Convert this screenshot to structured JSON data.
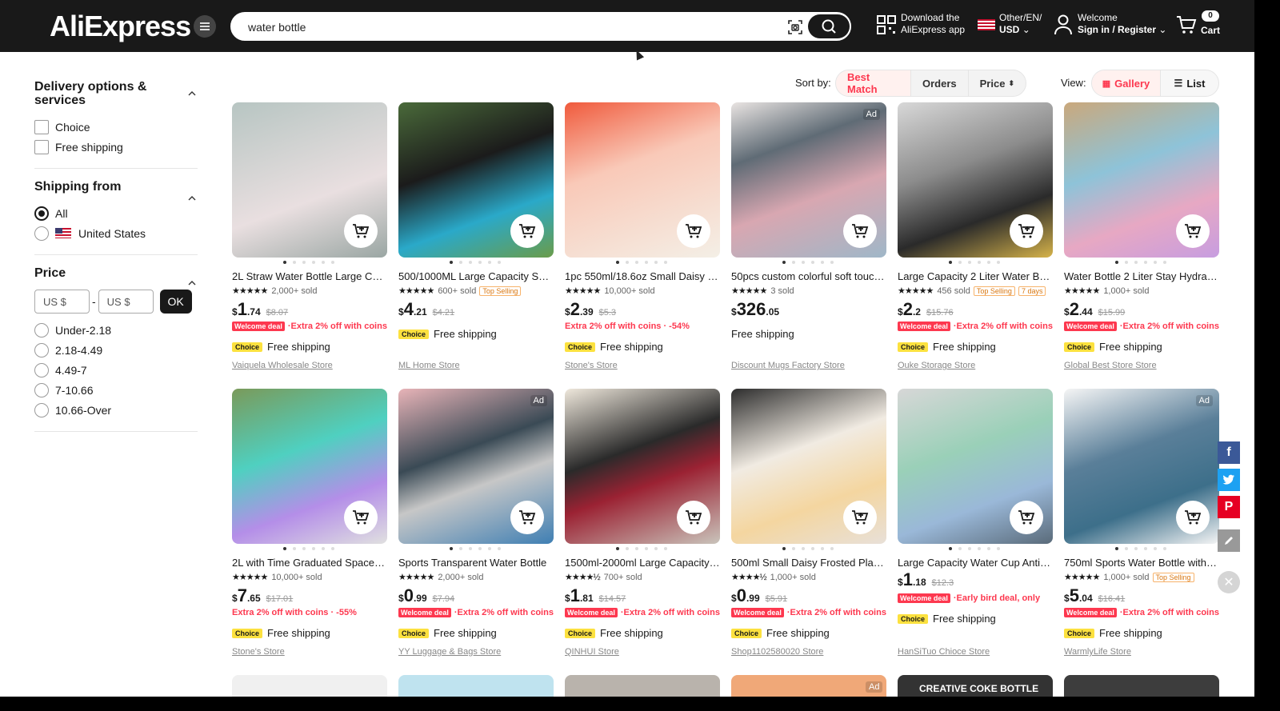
{
  "header": {
    "logo": "AliExpress",
    "search_value": "water bottle",
    "download_line1": "Download the",
    "download_line2": "AliExpress app",
    "lang_line1": "Other/EN/",
    "lang_line2": "USD",
    "account_line1": "Welcome",
    "account_line2": "Sign in / Register",
    "cart_label": "Cart",
    "cart_count": "0"
  },
  "sidebar": {
    "delivery_title": "Delivery options & services",
    "delivery_options": [
      "Choice",
      "Free shipping"
    ],
    "shipping_title": "Shipping from",
    "shipping_options": [
      "All",
      "United States"
    ],
    "price_title": "Price",
    "price_min_placeholder": "US $",
    "price_max_placeholder": "US $",
    "price_sep": "-",
    "ok_label": "OK",
    "price_ranges": [
      "Under-2.18",
      "2.18-4.49",
      "4.49-7",
      "7-10.66",
      "10.66-Over"
    ]
  },
  "sort": {
    "label": "Sort by:",
    "options": [
      "Best Match",
      "Orders",
      "Price"
    ],
    "selected": "Best Match"
  },
  "view": {
    "label": "View:",
    "options": [
      "Gallery",
      "List"
    ],
    "selected": "Gallery"
  },
  "products": [
    {
      "title": "2L Straw Water Bottle Large Capacity",
      "sold": "2,000+ sold",
      "tag": "",
      "tag2": "",
      "price_int": "1",
      "price_cents": ".74",
      "old": "$8.07",
      "welcome": true,
      "promo": "Extra 2% off with coins",
      "choice": true,
      "free_shipping": "Free shipping",
      "store": "Vaiquela Wholesale Store",
      "ad": false,
      "stars": "★★★★★"
    },
    {
      "title": "500/1000ML Large Capacity Sports Bottle",
      "sold": "600+ sold",
      "tag": "Top Selling",
      "tag2": "",
      "price_int": "4",
      "price_cents": ".21",
      "old": "$4.21",
      "welcome": false,
      "promo": "",
      "choice": true,
      "free_shipping": "Free shipping",
      "store": "ML Home Store",
      "ad": false,
      "stars": "★★★★★"
    },
    {
      "title": "1pc 550ml/18.6oz Small Daisy Bottle",
      "sold": "10,000+ sold",
      "tag": "",
      "tag2": "",
      "price_int": "2",
      "price_cents": ".39",
      "old": "$5.3",
      "welcome": false,
      "promo": "Extra 2% off with coins · -54%",
      "choice": true,
      "free_shipping": "Free shipping",
      "store": "Stone's Store",
      "ad": false,
      "stars": "★★★★★"
    },
    {
      "title": "50pcs custom colorful soft touch bottle",
      "sold": "3 sold",
      "tag": "",
      "tag2": "",
      "price_int": "326",
      "price_cents": ".05",
      "old": "",
      "welcome": false,
      "promo": "",
      "choice": false,
      "free_shipping": "Free shipping",
      "store": "Discount Mugs Factory Store",
      "ad": true,
      "stars": "★★★★★"
    },
    {
      "title": "Large Capacity 2 Liter Water Bottle",
      "sold": "456 sold",
      "tag": "Top Selling",
      "tag2": "7 days",
      "price_int": "2",
      "price_cents": ".2",
      "old": "$15.76",
      "welcome": true,
      "promo": "Extra 2% off with coins",
      "choice": true,
      "free_shipping": "Free shipping",
      "store": "Ouke Storage Store",
      "ad": false,
      "stars": "★★★★★"
    },
    {
      "title": "Water Bottle 2 Liter Stay Hydrated",
      "sold": "1,000+ sold",
      "tag": "",
      "tag2": "",
      "price_int": "2",
      "price_cents": ".44",
      "old": "$15.99",
      "welcome": true,
      "promo": "Extra 2% off with coins",
      "choice": true,
      "free_shipping": "Free shipping",
      "store": "Global Best Store Store",
      "ad": false,
      "stars": "★★★★★"
    },
    {
      "title": "2L with Time Graduated Space Bottle",
      "sold": "10,000+ sold",
      "tag": "",
      "tag2": "",
      "price_int": "7",
      "price_cents": ".65",
      "old": "$17.01",
      "welcome": false,
      "promo": "Extra 2% off with coins · -55%",
      "choice": true,
      "free_shipping": "Free shipping",
      "store": "Stone's Store",
      "ad": false,
      "stars": "★★★★★"
    },
    {
      "title": "Sports Transparent Water Bottle",
      "sold": "2,000+ sold",
      "tag": "",
      "tag2": "",
      "price_int": "0",
      "price_cents": ".99",
      "old": "$7.94",
      "welcome": true,
      "promo": "Extra 2% off with coins",
      "choice": true,
      "free_shipping": "Free shipping",
      "store": "YY Luggage & Bags Store",
      "ad": true,
      "stars": "★★★★★"
    },
    {
      "title": "1500ml-2000ml Large Capacity Bottle",
      "sold": "700+ sold",
      "tag": "",
      "tag2": "",
      "price_int": "1",
      "price_cents": ".81",
      "old": "$14.57",
      "welcome": true,
      "promo": "Extra 2% off with coins",
      "choice": true,
      "free_shipping": "Free shipping",
      "store": "QINHUI Store",
      "ad": false,
      "stars": "★★★★½"
    },
    {
      "title": "500ml Small Daisy Frosted Plastic Bottle",
      "sold": "1,000+ sold",
      "tag": "",
      "tag2": "",
      "price_int": "0",
      "price_cents": ".99",
      "old": "$5.91",
      "welcome": true,
      "promo": "Extra 2% off with coins",
      "choice": true,
      "free_shipping": "Free shipping",
      "store": "Shop1102580020 Store",
      "ad": false,
      "stars": "★★★★½"
    },
    {
      "title": "Large Capacity Water Cup Anti-fall",
      "sold": "",
      "tag": "",
      "tag2": "",
      "price_int": "1",
      "price_cents": ".18",
      "old": "$12.3",
      "welcome": true,
      "promo": "Early bird deal, only",
      "choice": true,
      "free_shipping": "Free shipping",
      "store": "HanSiTuo Chioce Store",
      "ad": false,
      "stars": ""
    },
    {
      "title": "750ml Sports Water Bottle with Straw",
      "sold": "1,000+ sold",
      "tag": "Top Selling",
      "tag2": "",
      "price_int": "5",
      "price_cents": ".04",
      "old": "$16.41",
      "welcome": true,
      "promo": "Extra 2% off with coins",
      "choice": true,
      "free_shipping": "Free shipping",
      "store": "WarmlyLife Store",
      "ad": true,
      "stars": "★★★★★"
    }
  ],
  "labels": {
    "welcome_deal": "Welcome deal",
    "choice": "Choice",
    "ad": "Ad",
    "currency": "$",
    "creative_coke": "CREATIVE COKE BOTTLE"
  },
  "colors": {
    "accent": "#fd384f",
    "header_bg": "#191919",
    "choice_yellow": "#fce13f"
  }
}
